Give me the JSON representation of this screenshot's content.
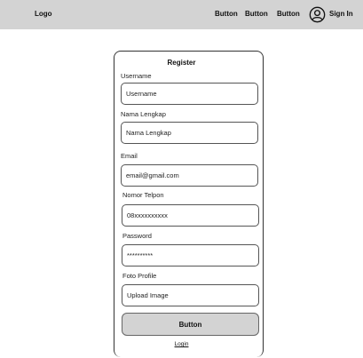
{
  "header": {
    "logo": "Logo",
    "nav_buttons": [
      "Button",
      "Button",
      "Button"
    ],
    "sign_in": "Sign In",
    "avatar_icon": "user-circle-icon"
  },
  "form": {
    "title": "Register",
    "fields": [
      {
        "label": "Username",
        "value": "Username"
      },
      {
        "label": "Nama Lengkap",
        "value": "Nama Lengkap"
      },
      {
        "label": "Email",
        "value": "email@gmail.com"
      },
      {
        "label": "Nomor Telpon",
        "value": "08xxxxxxxxxx"
      },
      {
        "label": "Password",
        "value": "**********"
      },
      {
        "label": "Foto Profile",
        "value": "Upload Image"
      }
    ],
    "submit_label": "Button",
    "login_link": "Login"
  },
  "colors": {
    "topbar": "#d3d3d3",
    "button_fill": "#d3d3d3"
  }
}
